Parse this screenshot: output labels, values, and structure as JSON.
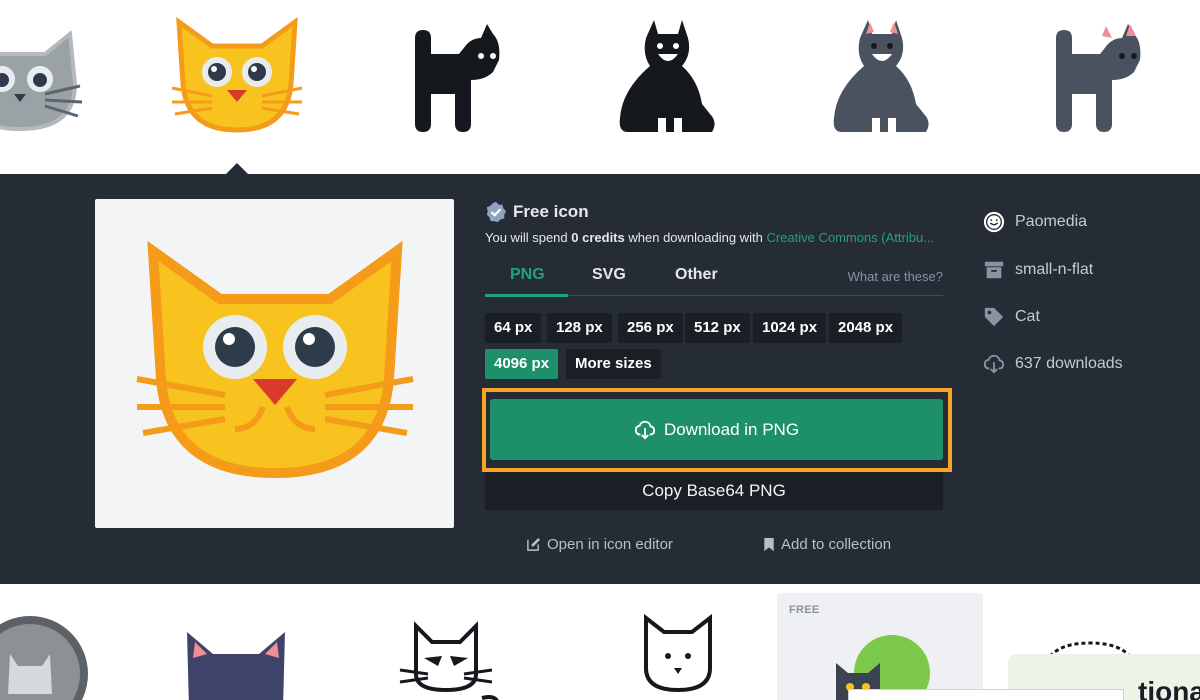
{
  "free_label": "Free icon",
  "spend": {
    "prefix": "You will spend",
    "credits": "0 credits",
    "middle": "when downloading with",
    "license": "Creative Commons (Attribu..."
  },
  "tabs": [
    "PNG",
    "SVG",
    "Other"
  ],
  "active_tab": "PNG",
  "what_link": "What are these?",
  "sizes": [
    "64 px",
    "128 px",
    "256 px",
    "512 px",
    "1024 px",
    "2048 px",
    "4096 px",
    "More sizes"
  ],
  "active_size": "4096 px",
  "download_label": "Download in PNG",
  "copy_label": "Copy Base64 PNG",
  "open_editor_label": "Open in icon editor",
  "add_collection_label": "Add to collection",
  "meta": {
    "author": "Paomedia",
    "pack": "small-n-flat",
    "tag": "Cat",
    "downloads": "637 downloads"
  },
  "free_card_tag": "FREE",
  "promo_text": "tiona",
  "colors": {
    "accent": "#1d8f6b",
    "panel": "#262c35",
    "highlight": "#f6a623"
  },
  "icons": [
    "cat-gray-icon",
    "cat-orange-icon",
    "cat-black-walking-icon",
    "cat-black-sitting-icon",
    "cat-gray-sitting-icon",
    "cat-gray-walking-icon"
  ]
}
